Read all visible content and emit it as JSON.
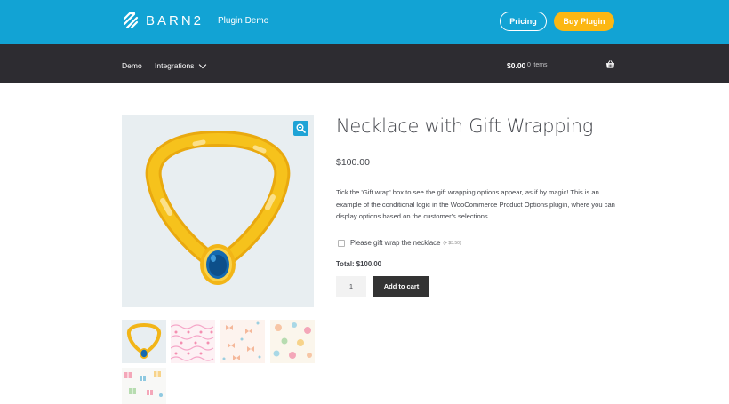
{
  "header": {
    "logo_text": "BARN2",
    "plugin_demo": "Plugin Demo",
    "pricing_label": "Pricing",
    "buy_label": "Buy Plugin",
    "accent_color": "#12a3d4",
    "buy_color": "#fcb712"
  },
  "nav": {
    "demo_label": "Demo",
    "integrations_label": "Integrations",
    "cart_amount": "$0.00",
    "cart_count": "0 items",
    "cart_icon": "basket-icon"
  },
  "gallery": {
    "zoom_icon": "magnifier-plus-icon",
    "thumbnails": [
      "necklace",
      "pink-hearts-pattern",
      "peach-bows-pattern",
      "pastel-ornaments-pattern",
      "gift-boxes-pattern"
    ]
  },
  "product": {
    "title": "Necklace with Gift Wrapping",
    "price": "$100.00",
    "description": "Tick the 'Gift wrap' box to see the gift wrapping options appear, as if by magic! This is an example of the conditional logic in the WooCommerce Product Options plugin, where you can display options based on the customer's selections.",
    "gift_label": "Please gift wrap the necklace",
    "gift_price": "(+ $3.50)",
    "gift_checked": false,
    "total": "Total: $100.00",
    "quantity": "1",
    "add_to_cart_label": "Add to cart"
  }
}
